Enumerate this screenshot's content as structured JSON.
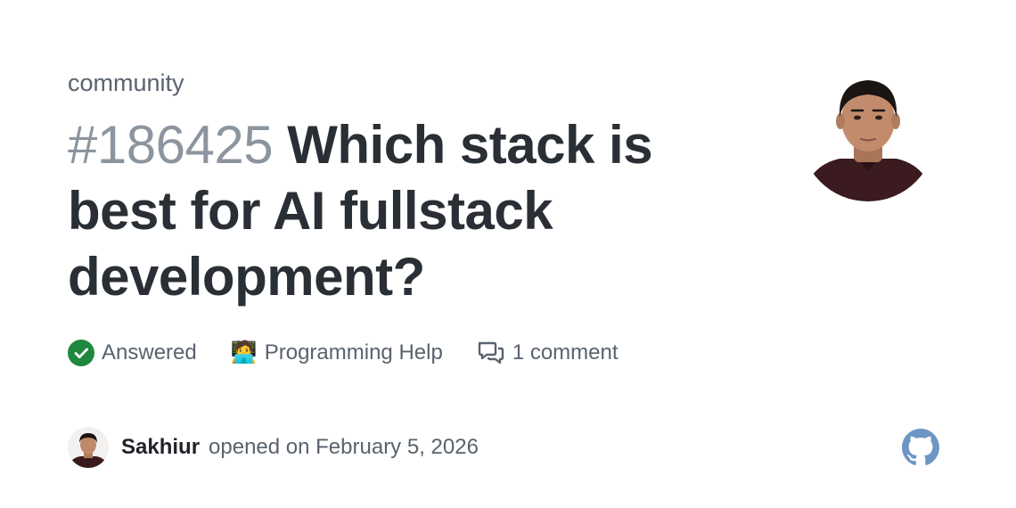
{
  "repo": {
    "name": "community"
  },
  "issue": {
    "number": "#186425",
    "title": "Which stack is best for AI fullstack development?"
  },
  "meta": {
    "status": "Answered",
    "category_emoji": "🧑‍💻",
    "category": "Programming Help",
    "comments": "1 comment"
  },
  "author": {
    "name": "Sakhiur",
    "opened_text": "opened on February 5, 2026"
  },
  "colors": {
    "answered": "#1f883d",
    "muted": "#59636e",
    "number": "#8c959f",
    "title": "#2a2f35"
  },
  "icons": {
    "status": "check-circle-icon",
    "comments": "comment-discussion-icon",
    "brand": "github-logo-icon"
  }
}
